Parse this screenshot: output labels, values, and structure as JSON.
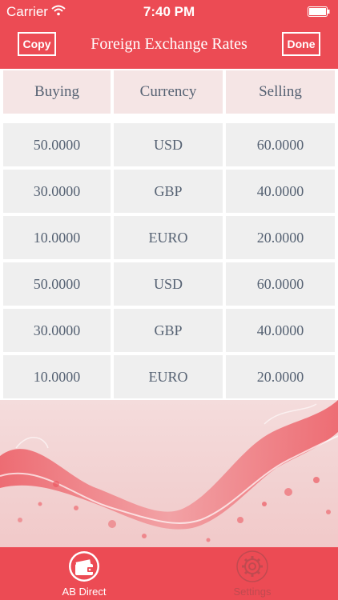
{
  "status_bar": {
    "carrier": "Carrier",
    "time": "7:40 PM"
  },
  "nav": {
    "copy_label": "Copy",
    "title": "Foreign Exchange Rates",
    "done_label": "Done"
  },
  "table": {
    "headers": [
      "Buying",
      "Currency",
      "Selling"
    ],
    "rows": [
      [
        "50.0000",
        "USD",
        "60.0000"
      ],
      [
        "30.0000",
        "GBP",
        "40.0000"
      ],
      [
        "10.0000",
        "EURO",
        "20.0000"
      ],
      [
        "50.0000",
        "USD",
        "60.0000"
      ],
      [
        "30.0000",
        "GBP",
        "40.0000"
      ],
      [
        "10.0000",
        "EURO",
        "20.0000"
      ]
    ]
  },
  "tabbar": {
    "items": [
      {
        "label": "AB Direct",
        "icon": "wallet-icon"
      },
      {
        "label": "Settings",
        "icon": "gear-icon"
      }
    ]
  },
  "colors": {
    "accent": "#ec4b54",
    "header_cell": "#f5e5e5",
    "cell": "#efefef",
    "text": "#566273"
  }
}
